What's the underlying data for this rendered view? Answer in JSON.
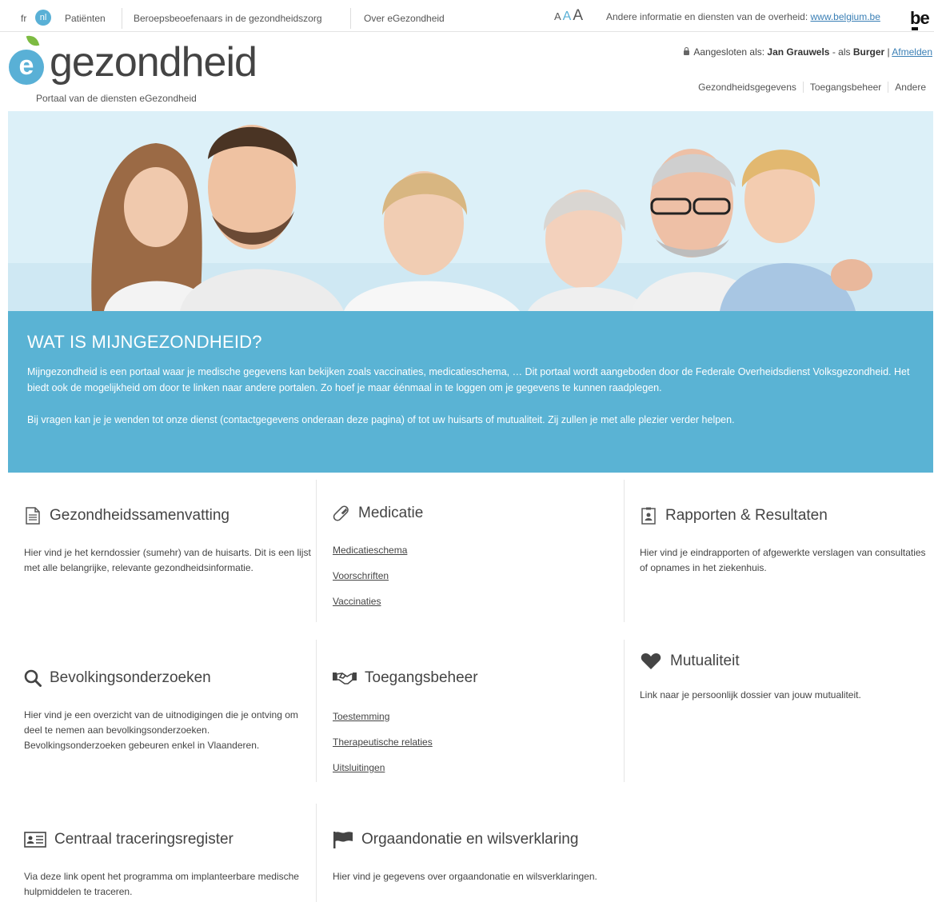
{
  "topbar": {
    "lang_fr": "fr",
    "lang_nl": "nl",
    "links": [
      "Patiënten",
      "Beroepsbeoefenaars in de gezondheidszorg",
      "Over eGezondheid"
    ],
    "font_sizes": [
      "A",
      "A",
      "A"
    ],
    "other_info": "Andere informatie en diensten van de overheid:",
    "other_info_link": "www.belgium.be",
    "be_logo": "be"
  },
  "header": {
    "logo_letter": "e",
    "logo_text": "gezondheid",
    "subtitle": "Portaal van de diensten eGezondheid",
    "logged_in_prefix": "Aangesloten als:",
    "user_name": "Jan Grauwels",
    "role_prefix": "- als",
    "role": "Burger",
    "logout": "Afmelden",
    "nav": [
      "Gezondheidsgegevens",
      "Toegangsbeheer",
      "Andere"
    ]
  },
  "intro": {
    "title": "WAT IS MIJNGEZONDHEID?",
    "p1": "Mijngezondheid is een portaal waar je medische gegevens kan bekijken zoals vaccinaties, medicatieschema, … Dit portaal wordt aangeboden door de Federale Overheidsdienst Volksgezondheid. Het biedt ook de mogelijkheid om door te linken naar andere portalen. Zo hoef je maar éénmaal in te loggen om je gegevens te kunnen raadplegen.",
    "p2": "Bij vragen kan je je wenden tot onze dienst (contactgegevens onderaan deze pagina) of tot uw huisarts of mutualiteit. Zij zullen je met alle plezier verder helpen."
  },
  "cards": {
    "summary": {
      "title": "Gezondheidssamenvatting",
      "desc": "Hier vind je het kerndossier (sumehr) van de huisarts. Dit is een lijst met alle belangrijke, relevante gezondheidsinformatie."
    },
    "medication": {
      "title": "Medicatie",
      "links": [
        "Medicatieschema",
        "Voorschriften",
        "Vaccinaties"
      ]
    },
    "reports": {
      "title": "Rapporten & Resultaten",
      "desc": "Hier vind je eindrapporten of afgewerkte verslagen van consultaties of opnames in het ziekenhuis."
    },
    "screening": {
      "title": "Bevolkingsonderzoeken",
      "desc": "Hier vind je een overzicht van de uitnodigingen die je ontving om deel te nemen aan bevolkingsonderzoeken. Bevolkingsonderzoeken gebeuren enkel in Vlaanderen."
    },
    "access": {
      "title": "Toegangsbeheer",
      "links": [
        "Toestemming",
        "Therapeutische relaties",
        "Uitsluitingen"
      ]
    },
    "mutuality": {
      "title": "Mutualiteit",
      "desc": "Link naar je persoonlijk dossier van jouw mutualiteit."
    },
    "tracing": {
      "title": "Centraal traceringsregister",
      "desc": "Via deze link opent het programma om implanteerbare medische hulpmiddelen te traceren."
    },
    "donation": {
      "title": "Orgaandonatie en wilsverklaring",
      "desc": "Hier vind je gegevens over orgaandonatie en wilsverklaringen."
    }
  },
  "colors": {
    "accent": "#5ab3d4",
    "leaf": "#7dbb42"
  }
}
